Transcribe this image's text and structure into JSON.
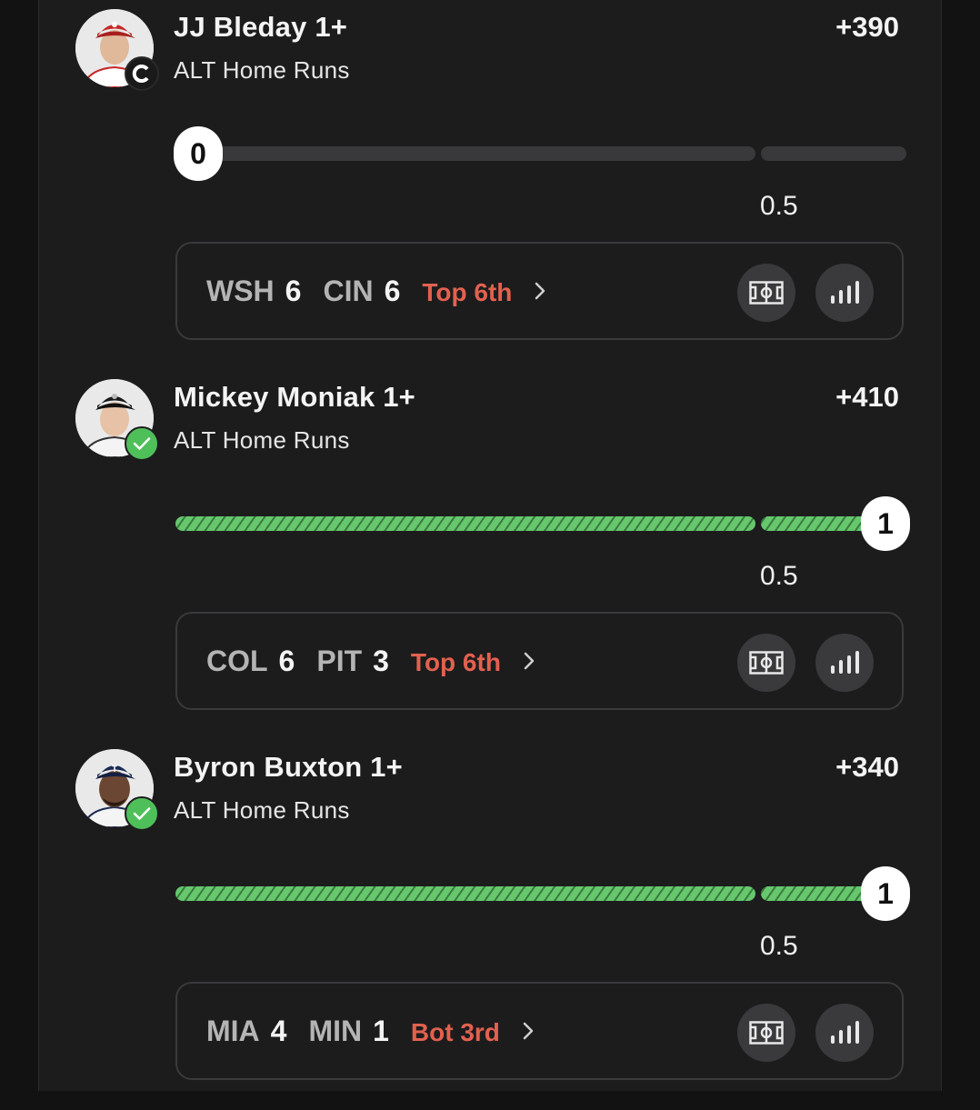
{
  "legs": [
    {
      "player": "JJ Bleday 1+",
      "market": "ALT Home Runs",
      "odds": "+390",
      "progress": 0,
      "line": "0.5",
      "knob_value": "0",
      "status": "pending",
      "badge": "cincinnati-c-logo",
      "game": {
        "away": "WSH",
        "away_score": "6",
        "home": "CIN",
        "home_score": "6",
        "inning": "Top 6th"
      }
    },
    {
      "player": "Mickey Moniak 1+",
      "market": "ALT Home Runs",
      "odds": "+410",
      "progress": 1,
      "line": "0.5",
      "knob_value": "1",
      "status": "won",
      "badge": "checkmark",
      "game": {
        "away": "COL",
        "away_score": "6",
        "home": "PIT",
        "home_score": "3",
        "inning": "Top 6th"
      }
    },
    {
      "player": "Byron Buxton 1+",
      "market": "ALT Home Runs",
      "odds": "+340",
      "progress": 1,
      "line": "0.5",
      "knob_value": "1",
      "status": "won",
      "badge": "checkmark",
      "game": {
        "away": "MIA",
        "away_score": "4",
        "home": "MIN",
        "home_score": "1",
        "inning": "Bot 3rd"
      }
    }
  ],
  "colors": {
    "background": "#1c1c1d",
    "success_green": "#66c76d",
    "inning_red": "#e2614f",
    "track_gray": "#39393b"
  },
  "icons": [
    "field-icon",
    "stats-bars-icon",
    "chevron-right-icon",
    "check-icon"
  ]
}
